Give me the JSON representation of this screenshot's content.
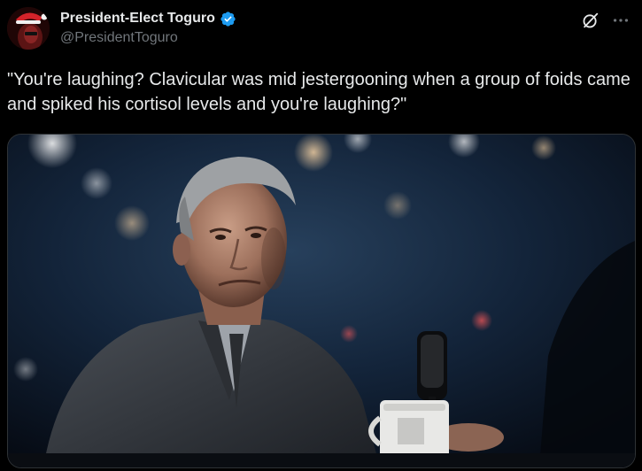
{
  "tweet": {
    "author": {
      "display_name": "President-Elect Toguro",
      "handle": "@PresidentToguro",
      "verified": true,
      "verified_color": "#1d9bf0"
    },
    "text": "\"You're laughing? Clavicular was mid jestergooning when a group of foids came and spiked his cortisol levels and you're laughing?\"",
    "icons": {
      "grok": "grok-icon",
      "more": "more-icon"
    },
    "colors": {
      "background": "#000000",
      "text": "#e7e9ea",
      "secondary": "#71767b",
      "border": "#2f3336"
    }
  }
}
